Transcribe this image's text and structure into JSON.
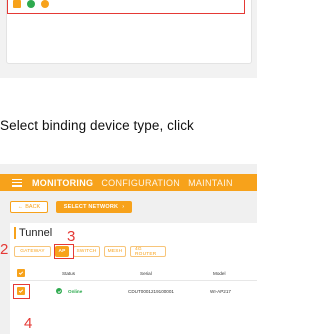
{
  "instruction": "Select binding device type, click",
  "navbar": {
    "items": [
      "MONITORING",
      "CONFIGURATION",
      "MAINTAIN"
    ]
  },
  "toolbar": {
    "back_label": "BACK",
    "select_network_label": "SELECT NETWORK"
  },
  "panel": {
    "title": "Tunnel",
    "tabs": [
      "GATEWAY",
      "AP",
      "SWITCH",
      "MESH",
      "4G ROUTER"
    ],
    "active_tab": "AP"
  },
  "table": {
    "columns": [
      "Status",
      "Serial",
      "Model"
    ],
    "rows": [
      {
        "status": "Online",
        "serial": "CDUT0001219100001",
        "model": "WI-AP217"
      }
    ]
  },
  "annotations": [
    "2",
    "3",
    "4"
  ],
  "colors": {
    "accent": "#f7a21b",
    "highlight": "#e53935",
    "online": "#2eaa4f"
  }
}
